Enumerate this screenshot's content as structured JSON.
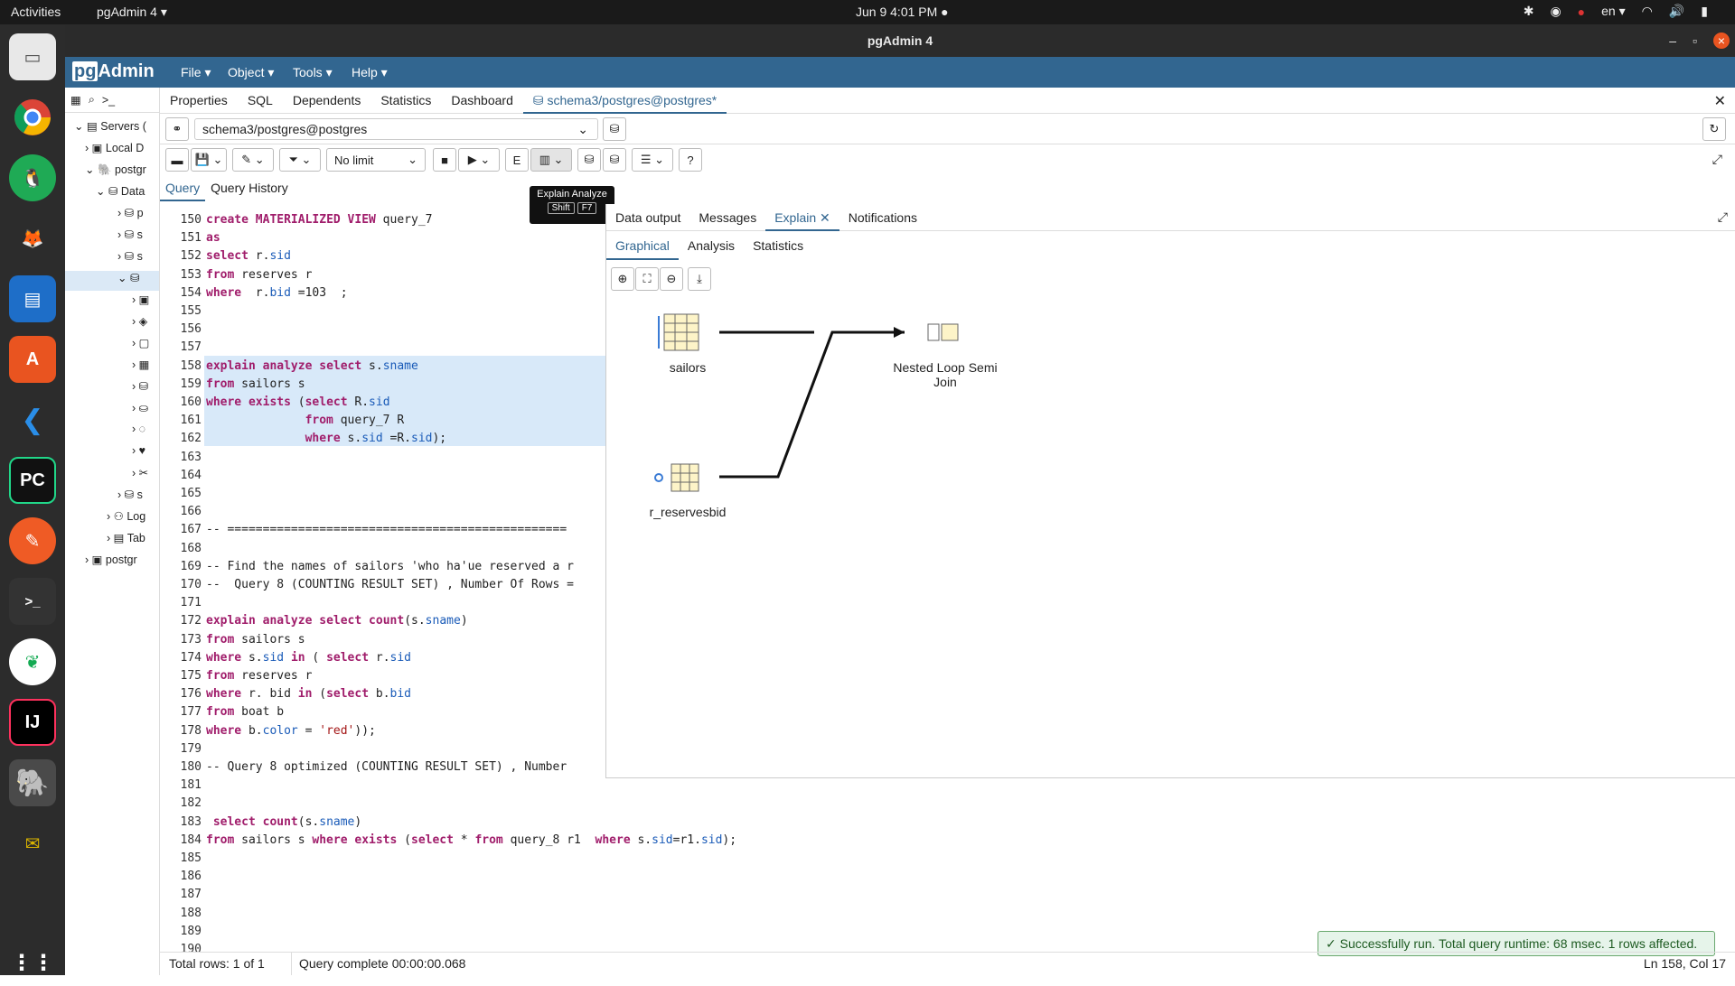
{
  "topbar": {
    "activities": "Activities",
    "app_name": "pgAdmin 4 ▾",
    "clock": "Jun 9  4:01 PM  ●",
    "lang": "en ▾"
  },
  "window": {
    "title": "pgAdmin 4"
  },
  "menu": {
    "logo_pg": "pg",
    "logo_admin": "Admin",
    "file": "File ▾",
    "object": "Object ▾",
    "tools": "Tools ▾",
    "help": "Help ▾"
  },
  "tree": {
    "items": [
      "Servers (",
      "Local D",
      "postgr",
      "Data",
      "p",
      "s",
      "s",
      "Log",
      "Tab",
      "postgr"
    ]
  },
  "main_tabs": {
    "properties": "Properties",
    "sql": "SQL",
    "dependents": "Dependents",
    "statistics": "Statistics",
    "dashboard": "Dashboard",
    "schema": "schema3/postgres@postgres*"
  },
  "connection": {
    "value": "schema3/postgres@postgres"
  },
  "toolbar": {
    "limit": "No limit"
  },
  "query_tabs": {
    "query": "Query",
    "history": "Query History"
  },
  "tooltip": {
    "title": "Explain Analyze",
    "key1": "Shift",
    "key2": "F7"
  },
  "editor": {
    "lines": [
      {
        "n": "150",
        "t": "create MATERIALIZED VIEW query_7"
      },
      {
        "n": "151",
        "t": "as"
      },
      {
        "n": "152",
        "t": "select r.sid"
      },
      {
        "n": "153",
        "t": "from reserves r"
      },
      {
        "n": "154",
        "t": "where  r.bid =103  ;"
      },
      {
        "n": "155",
        "t": ""
      },
      {
        "n": "156",
        "t": ""
      },
      {
        "n": "157",
        "t": ""
      },
      {
        "n": "158",
        "t": "explain analyze select s.sname"
      },
      {
        "n": "159",
        "t": "from sailors s"
      },
      {
        "n": "160",
        "t": "where exists (select R.sid"
      },
      {
        "n": "161",
        "t": "              from query_7 R"
      },
      {
        "n": "162",
        "t": "              where s.sid =R.sid);"
      },
      {
        "n": "163",
        "t": ""
      },
      {
        "n": "164",
        "t": ""
      },
      {
        "n": "165",
        "t": ""
      },
      {
        "n": "166",
        "t": ""
      },
      {
        "n": "167",
        "t": "-- ================================================"
      },
      {
        "n": "168",
        "t": ""
      },
      {
        "n": "169",
        "t": "-- Find the names of sailors 'who ha'ue reserved a r"
      },
      {
        "n": "170",
        "t": "--  Query 8 (COUNTING RESULT SET) , Number Of Rows ="
      },
      {
        "n": "171",
        "t": ""
      },
      {
        "n": "172",
        "t": "explain analyze select count(s.sname)"
      },
      {
        "n": "173",
        "t": "from sailors s"
      },
      {
        "n": "174",
        "t": "where s.sid in ( select r.sid"
      },
      {
        "n": "175",
        "t": "from reserves r"
      },
      {
        "n": "176",
        "t": "where r. bid in (select b.bid"
      },
      {
        "n": "177",
        "t": "from boat b"
      },
      {
        "n": "178",
        "t": "where b.color = 'red'));"
      },
      {
        "n": "179",
        "t": ""
      },
      {
        "n": "180",
        "t": "-- Query 8 optimized (COUNTING RESULT SET) , Number"
      },
      {
        "n": "181",
        "t": ""
      },
      {
        "n": "182",
        "t": ""
      },
      {
        "n": "183",
        "t": " select count(s.sname)"
      },
      {
        "n": "184",
        "t": "from sailors s where exists (select * from query_8 r1  where s.sid=r1.sid);"
      },
      {
        "n": "185",
        "t": ""
      },
      {
        "n": "186",
        "t": ""
      },
      {
        "n": "187",
        "t": ""
      },
      {
        "n": "188",
        "t": ""
      },
      {
        "n": "189",
        "t": ""
      },
      {
        "n": "190",
        "t": ""
      }
    ]
  },
  "results": {
    "tabs": {
      "data_output": "Data output",
      "messages": "Messages",
      "explain": "Explain",
      "notifications": "Notifications"
    },
    "sub_tabs": {
      "graphical": "Graphical",
      "analysis": "Analysis",
      "statistics": "Statistics"
    },
    "plan": {
      "node1": "sailors",
      "node2": "r_reservesbid",
      "node3_l1": "Nested Loop Semi",
      "node3_l2": "Join"
    }
  },
  "status": {
    "rows": "Total rows: 1 of 1",
    "complete": "Query complete 00:00:00.068",
    "position": "Ln 158, Col 17"
  },
  "toast": {
    "message": "Successfully run. Total query runtime: 68 msec. 1 rows affected."
  },
  "colors": {
    "brand": "#326690",
    "dock": "#2c2c2c",
    "highlight": "#d8e9f9"
  }
}
